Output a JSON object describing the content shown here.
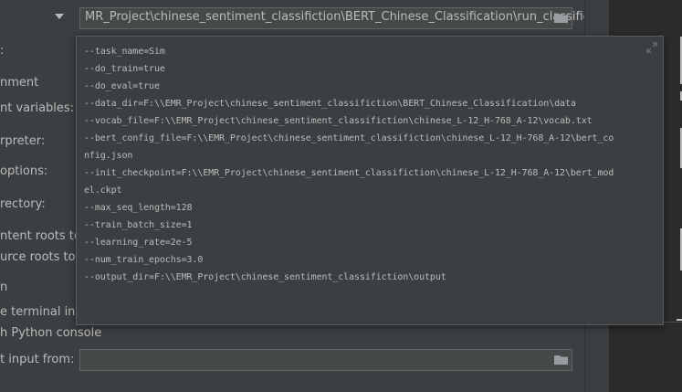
{
  "run_config": {
    "script_path": "MR_Project\\chinese_sentiment_classifiction\\BERT_Chinese_Classification\\run_classifier.py",
    "labels": {
      "parameters_partial": ":",
      "environment_section_partial": "nment",
      "env_variables_partial": "nt variables:",
      "interpreter_partial": "rpreter:",
      "interpreter_options_partial": "options:",
      "working_dir_partial": "rectory:",
      "content_roots_partial": "ntent roots to",
      "source_roots_partial": "urce roots to P",
      "execution_section_partial": "n",
      "terminal_partial": "e terminal in ou",
      "python_console_partial": "h Python console",
      "redirect_input_partial": "t input from:"
    },
    "redirect_input_value": ""
  },
  "params_popup": {
    "lines": [
      "--task_name=Sim",
      "--do_train=true",
      "--do_eval=true",
      "--data_dir=F:\\\\EMR_Project\\chinese_sentiment_classifiction\\BERT_Chinese_Classification\\data",
      "--vocab_file=F:\\\\EMR_Project\\chinese_sentiment_classifiction\\chinese_L-12_H-768_A-12\\vocab.txt",
      "--bert_config_file=F:\\\\EMR_Project\\chinese_sentiment_classifiction\\chinese_L-12_H-768_A-12\\bert_co",
      "nfig.json",
      "--init_checkpoint=F:\\\\EMR_Project\\chinese_sentiment_classifiction\\chinese_L-12_H-768_A-12\\bert_mod",
      "el.ckpt",
      "--max_seq_length=128",
      "--train_batch_size=1",
      "--learning_rate=2e-5",
      "--num_train_epochs=3.0",
      "--output_dir=F:\\\\EMR_Project\\chinese_sentiment_classifiction\\output"
    ]
  },
  "icons": {
    "browse": "folder-icon",
    "expand": "expand-icon",
    "dropdown": "chevron-down-icon"
  },
  "colors": {
    "background": "#3c3f41",
    "editor_background": "#2b2b2b",
    "text": "#bbbbbb",
    "field_background": "#45494a"
  }
}
